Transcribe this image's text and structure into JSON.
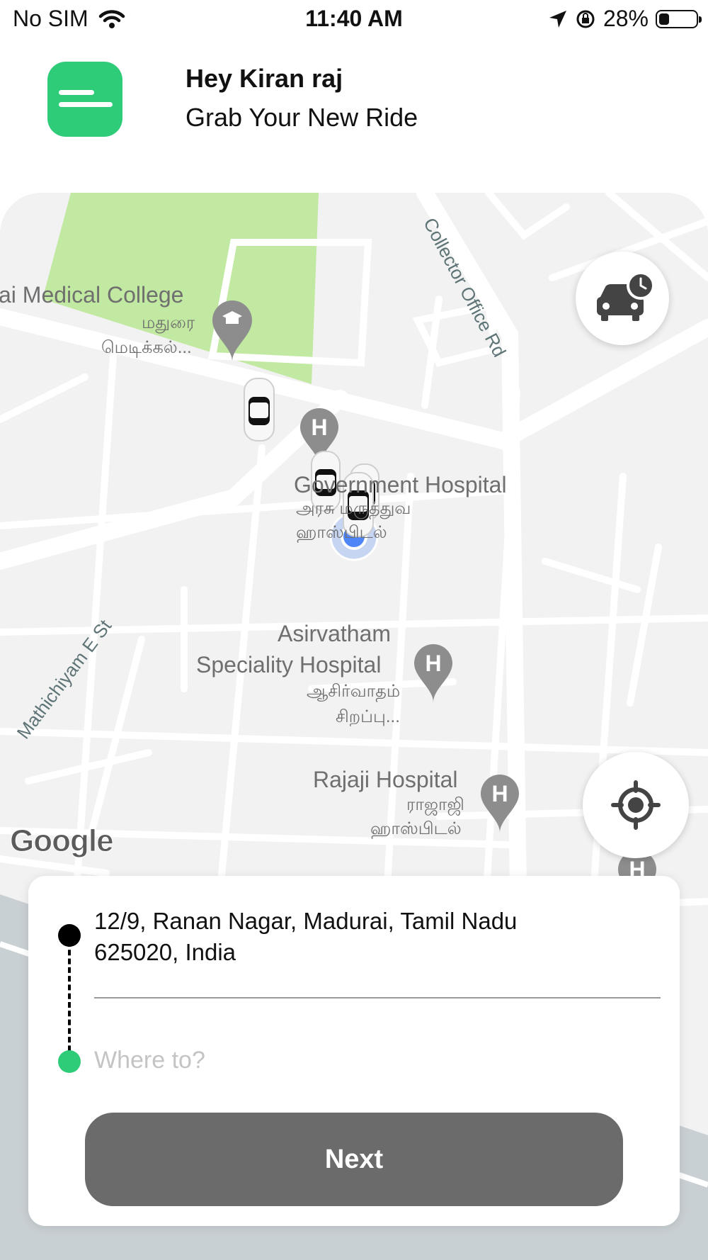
{
  "status_bar": {
    "carrier": "No SIM",
    "time": "11:40 AM",
    "battery": "28%",
    "battery_level": 0.28
  },
  "header": {
    "greeting": "Hey Kiran raj",
    "subtitle": "Grab Your New Ride",
    "menu_icon": "menu-icon",
    "accent_color": "#2ecb78"
  },
  "map": {
    "labels": {
      "medical_college": "ai Medical College",
      "medical_college_tamil_1": "மதுரை",
      "medical_college_tamil_2": "மெடிக்கல்...",
      "collector_rd": "Collector Office Rd",
      "govt_hospital": "Government Hospital",
      "govt_hospital_tamil_1": "அரசு மருத்துவ",
      "govt_hospital_tamil_2": "ஹாஸ்பிடல்",
      "mathichiyam": "Mathichiyam E St",
      "asirvatham_1": "Asirvatham",
      "asirvatham_2": "Speciality Hospital",
      "asirvatham_tamil_1": "ஆசிர்வாதம்",
      "asirvatham_tamil_2": "சிறப்பு...",
      "rajaji": "Rajaji Hospital",
      "rajaji_tamil_1": "ராஜாஜி",
      "rajaji_tamil_2": "ஹாஸ்பிடல்",
      "google": "Google",
      "hospital_marker": "H"
    },
    "schedule_icon": "car-clock-icon",
    "locate_icon": "crosshair-icon"
  },
  "trip": {
    "pickup_address": "12/9, Ranan Nagar, Madurai, Tamil Nadu 625020, India",
    "destination_value": "",
    "destination_placeholder": "Where to?",
    "next_label": "Next"
  }
}
